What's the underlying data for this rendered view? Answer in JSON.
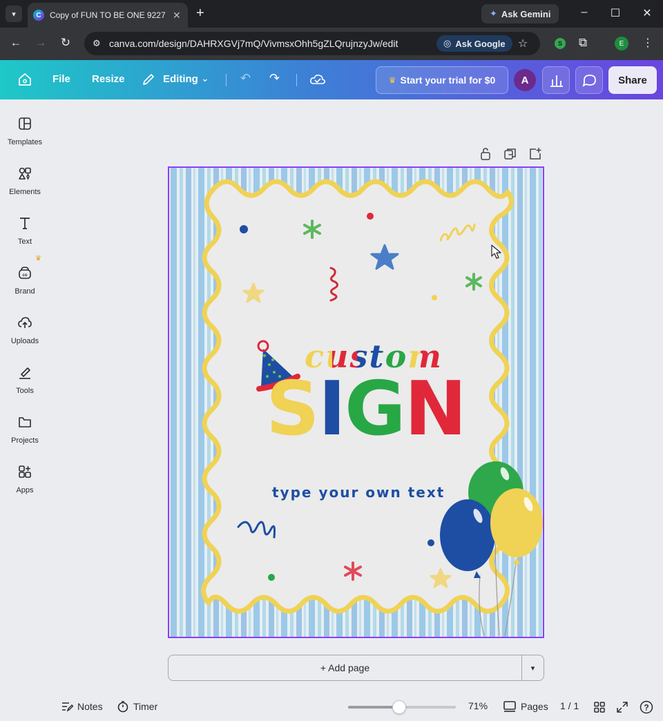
{
  "browser": {
    "tab_title": "Copy of FUN TO BE ONE 9227 C",
    "tab_close": "✕",
    "new_tab": "+",
    "ask_gemini": "Ask Gemini",
    "url": "canva.com/design/DAHRXGVj7mQ/VivmsxOhh5gZLQrujnzyJw/edit",
    "ask_google": "Ask Google",
    "profile_initial": "E",
    "extension_badge": "S"
  },
  "header": {
    "file": "File",
    "resize": "Resize",
    "editing": "Editing",
    "trial": "Start your trial for $0",
    "avatar": "A",
    "share": "Share",
    "gradient_start": "#1ec8c8",
    "gradient_end": "#6a45e0"
  },
  "sidebar": {
    "items": [
      {
        "label": "Templates",
        "icon": "templates-icon"
      },
      {
        "label": "Elements",
        "icon": "elements-icon"
      },
      {
        "label": "Text",
        "icon": "text-icon"
      },
      {
        "label": "Brand",
        "icon": "brand-icon"
      },
      {
        "label": "Uploads",
        "icon": "uploads-icon"
      },
      {
        "label": "Tools",
        "icon": "tools-icon"
      },
      {
        "label": "Projects",
        "icon": "projects-icon"
      },
      {
        "label": "Apps",
        "icon": "apps-icon"
      }
    ]
  },
  "design": {
    "title_top": "CUSTOM",
    "title_main": "SIGN",
    "subtitle": "type your own text",
    "colors": {
      "yellow": "#f0d255",
      "blue": "#1d4ea3",
      "green": "#28a745",
      "red": "#e0283a",
      "stripe_blue": "#8fc3e6",
      "paper": "#ebebeb"
    }
  },
  "canvas": {
    "add_page": "+ Add page",
    "frame_color": "#8b3dff"
  },
  "footer": {
    "notes": "Notes",
    "timer": "Timer",
    "zoom_percent": 71,
    "zoom_label": "71%",
    "pages": "Pages",
    "page_count": "1 / 1"
  }
}
